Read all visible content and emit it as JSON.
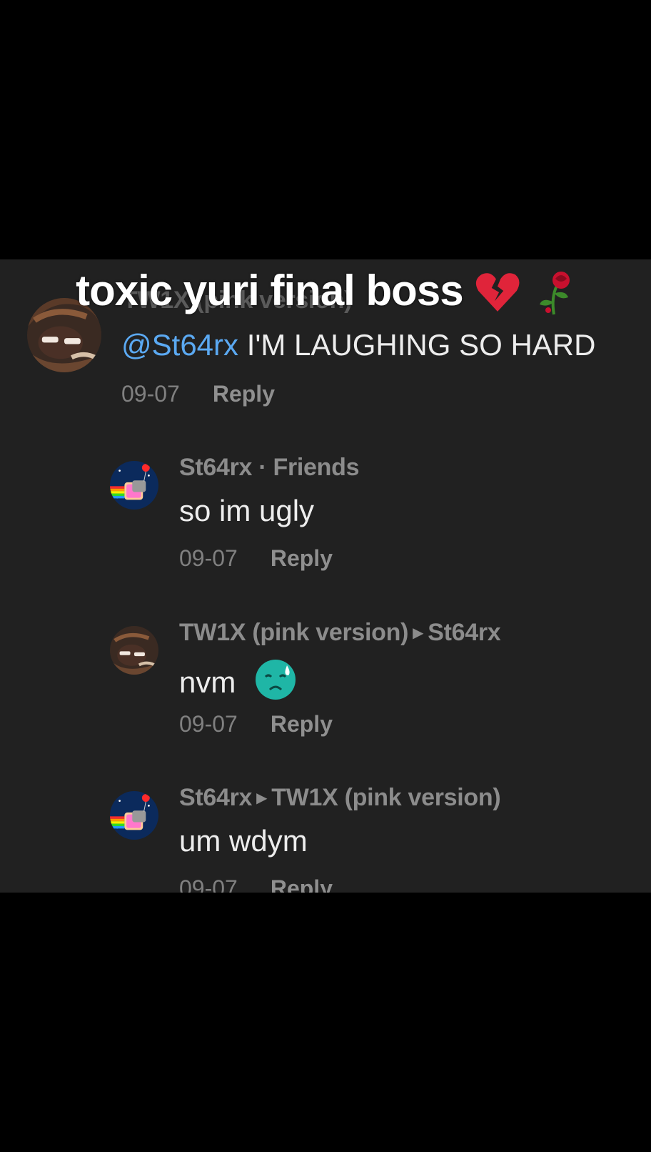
{
  "overlay": {
    "title": "toxic yuri final boss",
    "emojis": [
      "broken-heart-icon",
      "wilted-rose-icon"
    ]
  },
  "comments": [
    {
      "username": "TW1X (pink version)",
      "mention": "@St64rx",
      "text": "I'M LAUGHING SO HARD",
      "date": "09-07",
      "reply_label": "Reply"
    },
    {
      "username": "St64rx",
      "username_suffix": " · Friends",
      "text": "so im ugly",
      "date": "09-07",
      "reply_label": "Reply"
    },
    {
      "username": "TW1X (pink version)",
      "reply_to": "St64rx",
      "text": "nvm",
      "emoji": "sad-sweat-face-icon",
      "date": "09-07",
      "reply_label": "Reply"
    },
    {
      "username": "St64rx",
      "reply_to": "TW1X (pink version)",
      "text": "um wdym",
      "date": "09-07",
      "reply_label": "Reply"
    }
  ],
  "colors": {
    "background": "#000000",
    "panel": "#212121",
    "mention": "#5ba9f2",
    "username": "#8c8c8c",
    "body_text": "#ededed"
  }
}
